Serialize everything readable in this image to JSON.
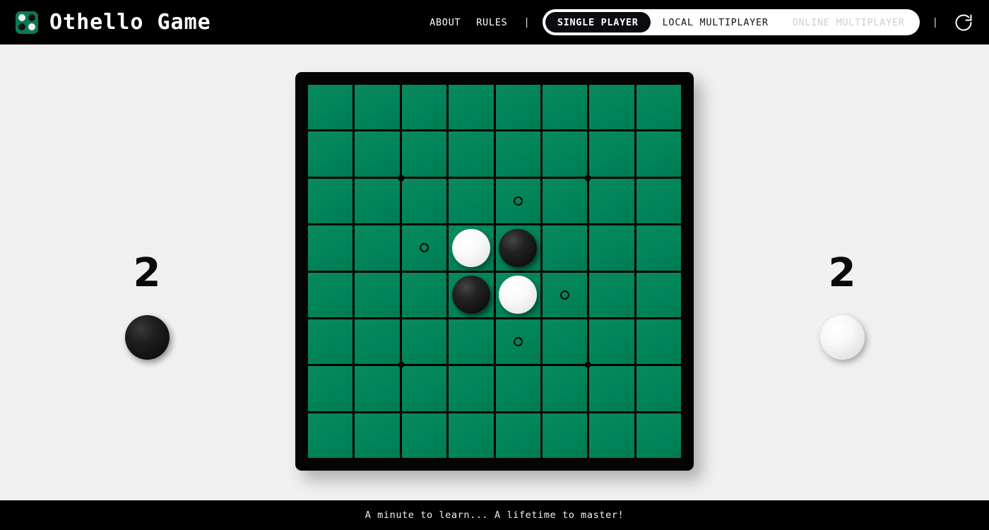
{
  "header": {
    "title": "Othello Game",
    "logo_icon": "othello-logo-icon",
    "logo_discs": [
      "white",
      "black",
      "black",
      "white"
    ],
    "nav_links": [
      {
        "label": "ABOUT",
        "name": "nav-link-about"
      },
      {
        "label": "RULES",
        "name": "nav-link-rules"
      }
    ],
    "separator": "|",
    "modes": [
      {
        "label": "SINGLE PLAYER",
        "state": "active"
      },
      {
        "label": "LOCAL MULTIPLAYER",
        "state": "inactive"
      },
      {
        "label": "ONLINE MULTIPLAYER",
        "state": "disabled"
      }
    ],
    "separator2": "|",
    "refresh_icon": "refresh-icon"
  },
  "scores": {
    "black": {
      "value": "2",
      "disc_color": "black"
    },
    "white": {
      "value": "2",
      "disc_color": "white"
    }
  },
  "board": {
    "size": 8,
    "cell_color": "#00875A",
    "frame_color": "#040404",
    "star_points": [
      {
        "x": 2,
        "y": 2
      },
      {
        "x": 6,
        "y": 2
      },
      {
        "x": 2,
        "y": 6
      },
      {
        "x": 6,
        "y": 6
      }
    ],
    "cells": [
      [
        "",
        "",
        "",
        "",
        "",
        "",
        "",
        ""
      ],
      [
        "",
        "",
        "",
        "",
        "",
        "",
        "",
        ""
      ],
      [
        "",
        "",
        "",
        "",
        "hint",
        "",
        "",
        ""
      ],
      [
        "",
        "",
        "hint",
        "white",
        "black",
        "",
        "",
        ""
      ],
      [
        "",
        "",
        "",
        "black",
        "white",
        "hint",
        "",
        ""
      ],
      [
        "",
        "",
        "",
        "",
        "hint",
        "",
        "",
        ""
      ],
      [
        "",
        "",
        "",
        "",
        "",
        "",
        "",
        ""
      ],
      [
        "",
        "",
        "",
        "",
        "",
        "",
        "",
        ""
      ]
    ]
  },
  "footer": {
    "tagline": "A minute to learn... A lifetime to master!"
  },
  "colors": {
    "page_background": "#f0f0f0",
    "header_background": "#000000",
    "board_green": "#00875A",
    "accent_white": "#ffffff"
  }
}
